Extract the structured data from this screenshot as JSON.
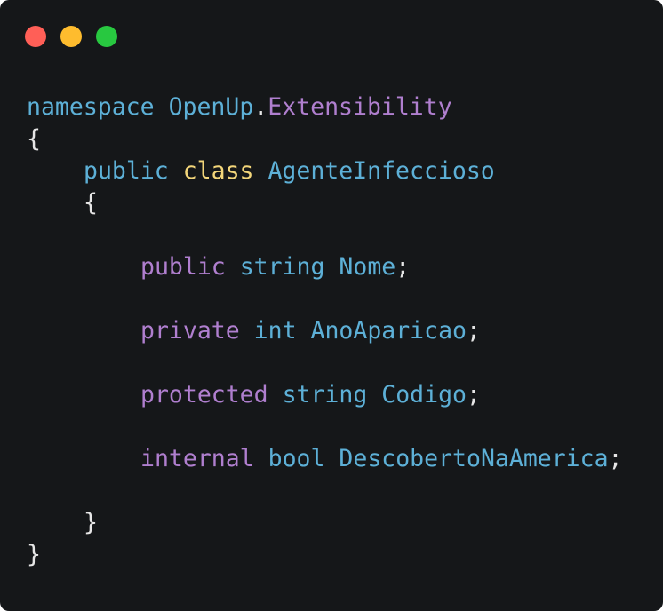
{
  "window": {
    "traffic_lights": [
      {
        "name": "close",
        "color": "#ff5f57"
      },
      {
        "name": "minimize",
        "color": "#febc2e"
      },
      {
        "name": "maximize",
        "color": "#28c840"
      }
    ]
  },
  "colors": {
    "background": "#151719",
    "keyword_blue": "#5db0d7",
    "keyword_purple": "#b07fcf",
    "keyword_yellow": "#f3d67a",
    "punctuation": "#e6e6e6"
  },
  "code": {
    "line1": {
      "kw": "namespace",
      "ns1": "OpenUp",
      "dot": ".",
      "ns2": "Extensibility"
    },
    "line2": {
      "brace": "{"
    },
    "line3": {
      "kw1": "public",
      "kw2": "class",
      "name": "AgenteInfeccioso"
    },
    "line4": {
      "brace": "{"
    },
    "line5": {
      "mod": "public",
      "type": "string",
      "name": "Nome",
      "semi": ";"
    },
    "line6": {
      "mod": "private",
      "type": "int",
      "name": "AnoAparicao",
      "semi": ";"
    },
    "line7": {
      "mod": "protected",
      "type": "string",
      "name": "Codigo",
      "semi": ";"
    },
    "line8": {
      "mod": "internal",
      "type": "bool",
      "name": "DescobertoNaAmerica",
      "semi": ";"
    },
    "line9": {
      "brace": "}"
    },
    "line10": {
      "brace": "}"
    }
  }
}
